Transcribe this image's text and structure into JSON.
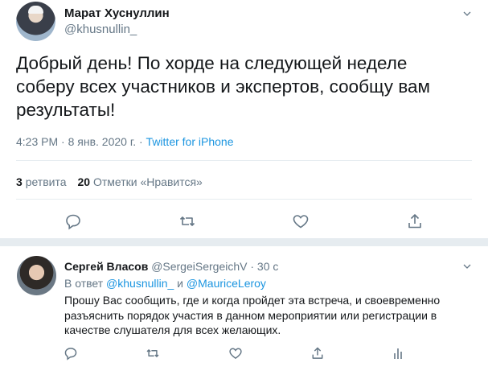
{
  "main_tweet": {
    "author_name": "Марат Хуснуллин",
    "author_handle": "@khusnullin_",
    "text": "Добрый день! По хорде на следующей неделе соберу всех участников и экспертов, сообщу вам результаты!",
    "time": "4:23 PM · 8 янв. 2020 г. · ",
    "source": "Twitter for iPhone",
    "retweets_count": "3",
    "retweets_label": "ретвита",
    "likes_count": "20",
    "likes_label": "Отметки «Нравится»"
  },
  "reply_tweet": {
    "author_name": "Сергей Власов",
    "author_handle": "@SergeiSergeichV",
    "time": " · 30 с",
    "reply_prefix": "В ответ ",
    "mention_1": "@khusnullin_",
    "reply_joiner": " и ",
    "mention_2": "@MauriceLeroy",
    "text": "Прошу Вас сообщить, где и когда пройдет эта встреча, и своевременно разъяснить порядок участия в данном мероприятии или регистрации в качестве слушателя для всех желающих."
  },
  "icons": {
    "caret": "chevron-down-icon",
    "reply": "reply-icon",
    "retweet": "retweet-icon",
    "like": "heart-icon",
    "share": "share-icon",
    "analytics": "analytics-icon"
  },
  "colors": {
    "link": "#1b95e0",
    "secondary_text": "#657786",
    "primary_text": "#14171a",
    "divider": "#e6ecf0"
  }
}
